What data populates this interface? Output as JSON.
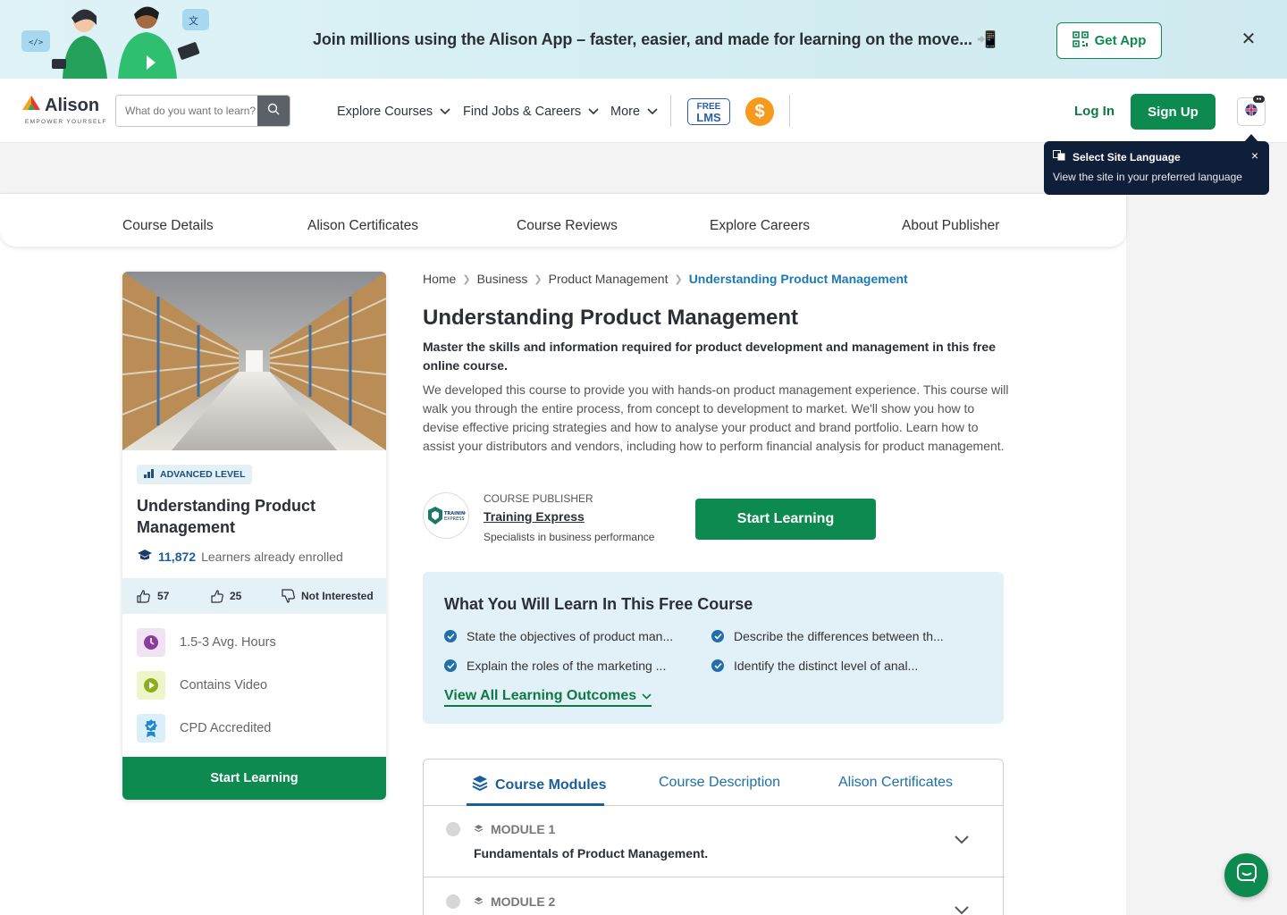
{
  "promo": {
    "text": "Join millions using the Alison App – faster, easier, and made for learning on the move... 📲",
    "button": "Get App"
  },
  "header": {
    "logo": "Alison",
    "tagline": "EMPOWER YOURSELF",
    "search_placeholder": "What do you want to learn?",
    "nav": [
      "Explore Courses",
      "Find Jobs & Careers",
      "More"
    ],
    "lms_top": "FREE",
    "lms_bottom": "LMS",
    "coin": "$",
    "login": "Log In",
    "signup": "Sign Up"
  },
  "lang_tooltip": {
    "title": "Select Site Language",
    "subtitle": "View the site in your preferred language",
    "close": "×"
  },
  "subnav": [
    "Course Details",
    "Alison Certificates",
    "Course Reviews",
    "Explore Careers",
    "About Publisher"
  ],
  "card": {
    "level": "ADVANCED LEVEL",
    "title": "Understanding Product Management",
    "enrolled_count": "11,872",
    "enrolled_label": "Learners already enrolled",
    "likes": "57",
    "thumbs": "25",
    "not_interested": "Not Interested",
    "features": [
      "1.5-3 Avg. Hours",
      "Contains Video",
      "CPD Accredited"
    ],
    "button": "Start Learning"
  },
  "breadcrumb": [
    "Home",
    "Business",
    "Product Management",
    "Understanding Product Management"
  ],
  "main": {
    "title": "Understanding Product Management",
    "subtitle": "Master the skills and information required for product development and management in this free online course.",
    "description": "We developed this course to provide you with hands-on product management experience. This course will walk you through the entire process, from concept to development to market. We'll show you how to devise effective pricing strategies and how to analyse your product and brand portfolio. Learn how to assist your distributors and vendors, including how to perform financial analysis for product management.",
    "publisher_label": "COURSE PUBLISHER",
    "publisher_name": "Training Express",
    "publisher_desc": "Specialists in business performance",
    "button": "Start Learning"
  },
  "learn": {
    "title": "What You Will Learn In This Free Course",
    "items": [
      "State the objectives of product man...",
      "Describe the differences between th...",
      "Explain the roles of the marketing ...",
      "Identify the distinct level of anal..."
    ],
    "link": "View All Learning Outcomes"
  },
  "modules": {
    "tabs": [
      "Course Modules",
      "Course Description",
      "Alison Certificates"
    ],
    "rows": [
      {
        "label": "MODULE 1",
        "name": "Fundamentals of Product Management."
      },
      {
        "label": "MODULE 2",
        "name": ""
      }
    ]
  },
  "colors": {
    "brand_green": "#0d8a4f",
    "link_blue": "#1a5e9c",
    "tooltip_bg": "#0f1f3a",
    "learn_bg": "#e2f1f7"
  }
}
